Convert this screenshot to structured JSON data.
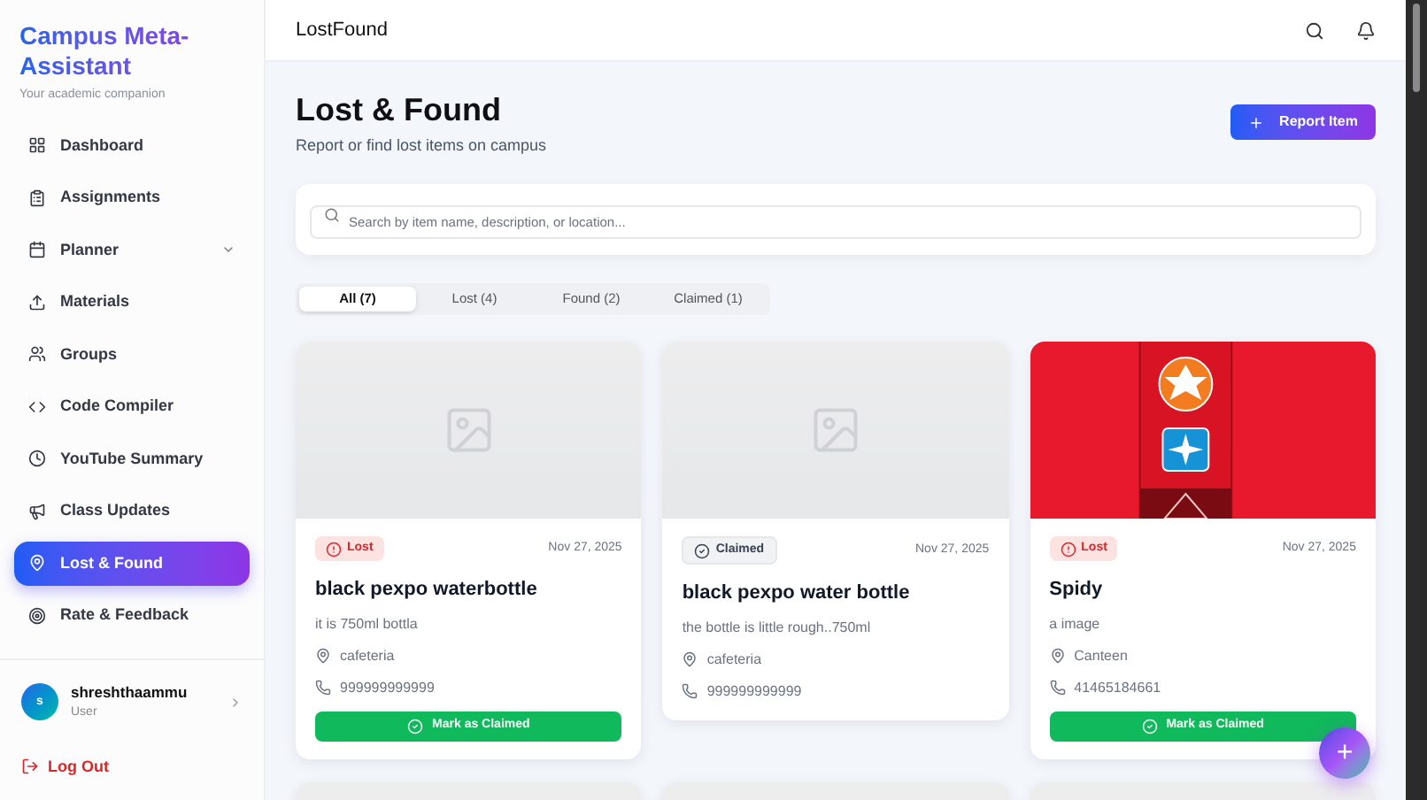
{
  "sidebar": {
    "brand": {
      "title": "Campus Meta-Assistant",
      "subtitle": "Your academic companion"
    },
    "items": [
      {
        "label": "Dashboard",
        "kind": "link",
        "selected": false
      },
      {
        "label": "Assignments",
        "kind": "link",
        "selected": false
      },
      {
        "label": "Planner",
        "kind": "submenu",
        "selected": false
      },
      {
        "label": "Materials",
        "kind": "link",
        "selected": false
      },
      {
        "label": "Groups",
        "kind": "link",
        "selected": false
      },
      {
        "label": "Code Compiler",
        "kind": "link",
        "selected": false
      },
      {
        "label": "YouTube Summary",
        "kind": "link",
        "selected": false
      },
      {
        "label": "Class Updates",
        "kind": "link",
        "selected": false
      },
      {
        "label": "Lost & Found",
        "kind": "link",
        "selected": true
      },
      {
        "label": "Rate & Feedback",
        "kind": "link",
        "selected": false
      }
    ],
    "user": {
      "avatar": "s",
      "name": "shreshthaammu",
      "role": "User"
    },
    "logout": "Log Out"
  },
  "header": {
    "title": "LostFound"
  },
  "page": {
    "title": "Lost & Found",
    "subtitle": "Report or find lost items on campus",
    "action": "Report Item"
  },
  "search": {
    "placeholder": "Search by item name, description, or location..."
  },
  "tabs": [
    {
      "label": "All (7)",
      "selected": true
    },
    {
      "label": "Lost (4)",
      "selected": false
    },
    {
      "label": "Found (2)",
      "selected": false
    },
    {
      "label": "Claimed (1)",
      "selected": false
    }
  ],
  "cards": [
    {
      "image": {
        "kind": "placeholder"
      },
      "status": {
        "kind": "lost",
        "label": "Lost"
      },
      "date": "Nov 27, 2025",
      "title": "black pexpo waterbottle",
      "description": "it is 750ml bottla",
      "location": "cafeteria",
      "phone": "999999999999",
      "action": "Mark as Claimed"
    },
    {
      "image": {
        "kind": "placeholder"
      },
      "status": {
        "kind": "claimed",
        "label": "Claimed"
      },
      "date": "Nov 27, 2025",
      "title": "black pexpo water bottle",
      "description": "the bottle is little rough..750ml",
      "location": "cafeteria",
      "phone": "999999999999"
    },
    {
      "status": {
        "kind": "lost",
        "label": "Lost"
      },
      "date": "Nov 27, 2025",
      "title": "Spidy",
      "description": "a image",
      "location": "Canteen",
      "phone": "41465184661",
      "action": "Mark as Claimed"
    },
    {
      "image": {
        "kind": "blank"
      }
    },
    {
      "image": {
        "kind": "blank"
      }
    },
    {
      "image": {
        "kind": "blank"
      }
    }
  ],
  "fab": "+"
}
